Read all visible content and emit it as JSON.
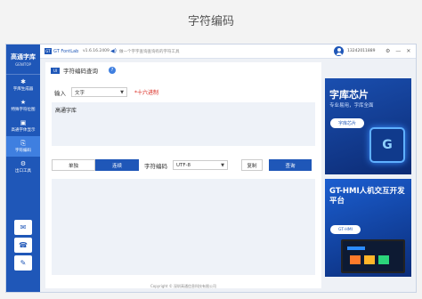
{
  "page_title": "字符编码",
  "sidebar": {
    "logo_text": "高通字库",
    "logo_sub": "GENITOP",
    "items": [
      {
        "label": "字库生成器",
        "icon": "font-generator-icon"
      },
      {
        "label": "特殊字符位图",
        "icon": "star-icon"
      },
      {
        "label": "高通字体显示",
        "icon": "display-icon"
      },
      {
        "label": "字符编码",
        "icon": "encoding-icon",
        "active": true
      },
      {
        "label": "出口工具",
        "icon": "tools-icon"
      }
    ],
    "bottom_buttons": [
      "chat-icon",
      "phone-icon",
      "mail-icon"
    ]
  },
  "topbar": {
    "brand": "GT FontLab",
    "version": "v1.6.16.2409",
    "notice": "做一个字字查询查询有的字符工具",
    "user": "13242011889"
  },
  "tool": {
    "badge": "UI",
    "title": "字符编码查询",
    "help": "?",
    "input_label": "输入",
    "input_type": "文字",
    "hex_label": "*十六进制",
    "input_text": "高通字库",
    "tabs": [
      "单独",
      "连续"
    ],
    "active_tab": 1,
    "encoding_label": "字符编码",
    "encoding_value": "UTF-8",
    "copy_label": "复制",
    "query_label": "查询"
  },
  "copyright": "Copyright © 深圳高通信息科技有限公司",
  "ads": {
    "ad1": {
      "title": "字库芯片",
      "subtitle": "专业易用，字库全面",
      "button": "字库芯片",
      "chip_text": "G"
    },
    "ad2": {
      "title": "GT-HMI人机交互开发平台",
      "button": "GT-HMI"
    }
  },
  "colors": {
    "primary": "#1f57b8",
    "accent": "#3f7fe0",
    "hex_red": "#d9261c"
  }
}
